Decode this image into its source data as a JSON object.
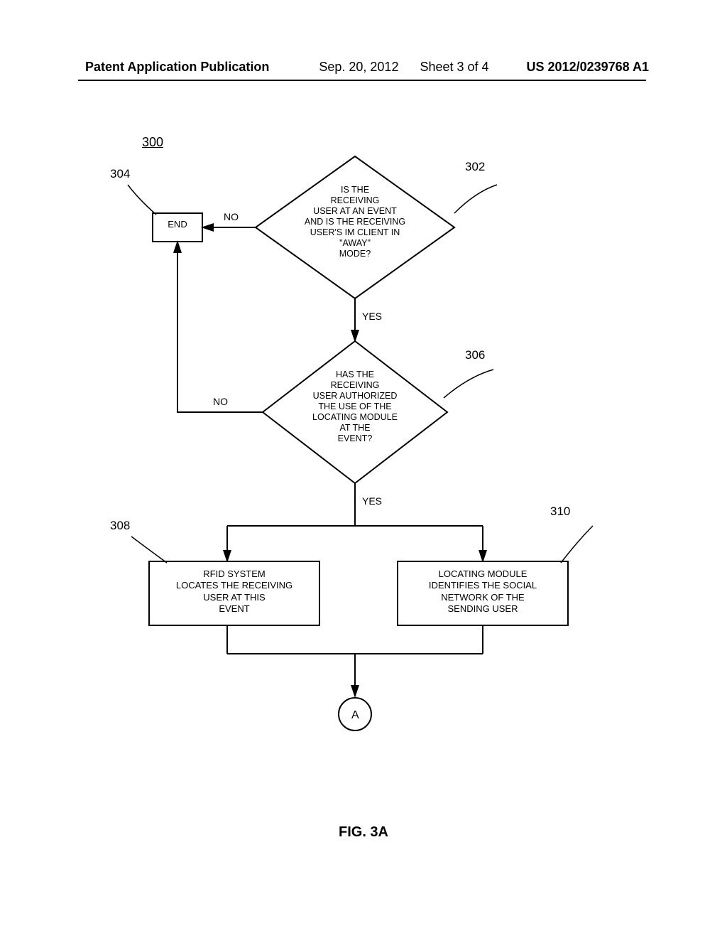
{
  "header": {
    "pub_label": "Patent Application Publication",
    "date": "Sep. 20, 2012",
    "sheet": "Sheet 3 of 4",
    "pub_number": "US 2012/0239768 A1"
  },
  "figure": {
    "number": "300",
    "caption": "FIG. 3A",
    "connector": "A"
  },
  "refs": {
    "r302": "302",
    "r304": "304",
    "r306": "306",
    "r308": "308",
    "r310": "310"
  },
  "labels": {
    "yes": "YES",
    "no": "NO"
  },
  "nodes": {
    "end": "END",
    "d302": "IS THE\nRECEIVING\nUSER AT AN EVENT\nAND IS THE RECEIVING\nUSER'S IM CLIENT IN\n\"AWAY\"\nMODE?",
    "d306": "HAS THE\nRECEIVING\nUSER AUTHORIZED\nTHE USE OF THE\nLOCATING MODULE\nAT THE\nEVENT?",
    "b308": "RFID SYSTEM\nLOCATES THE RECEIVING\nUSER AT THIS\nEVENT",
    "b310": "LOCATING MODULE\nIDENTIFIES THE SOCIAL\nNETWORK OF THE\nSENDING USER"
  }
}
